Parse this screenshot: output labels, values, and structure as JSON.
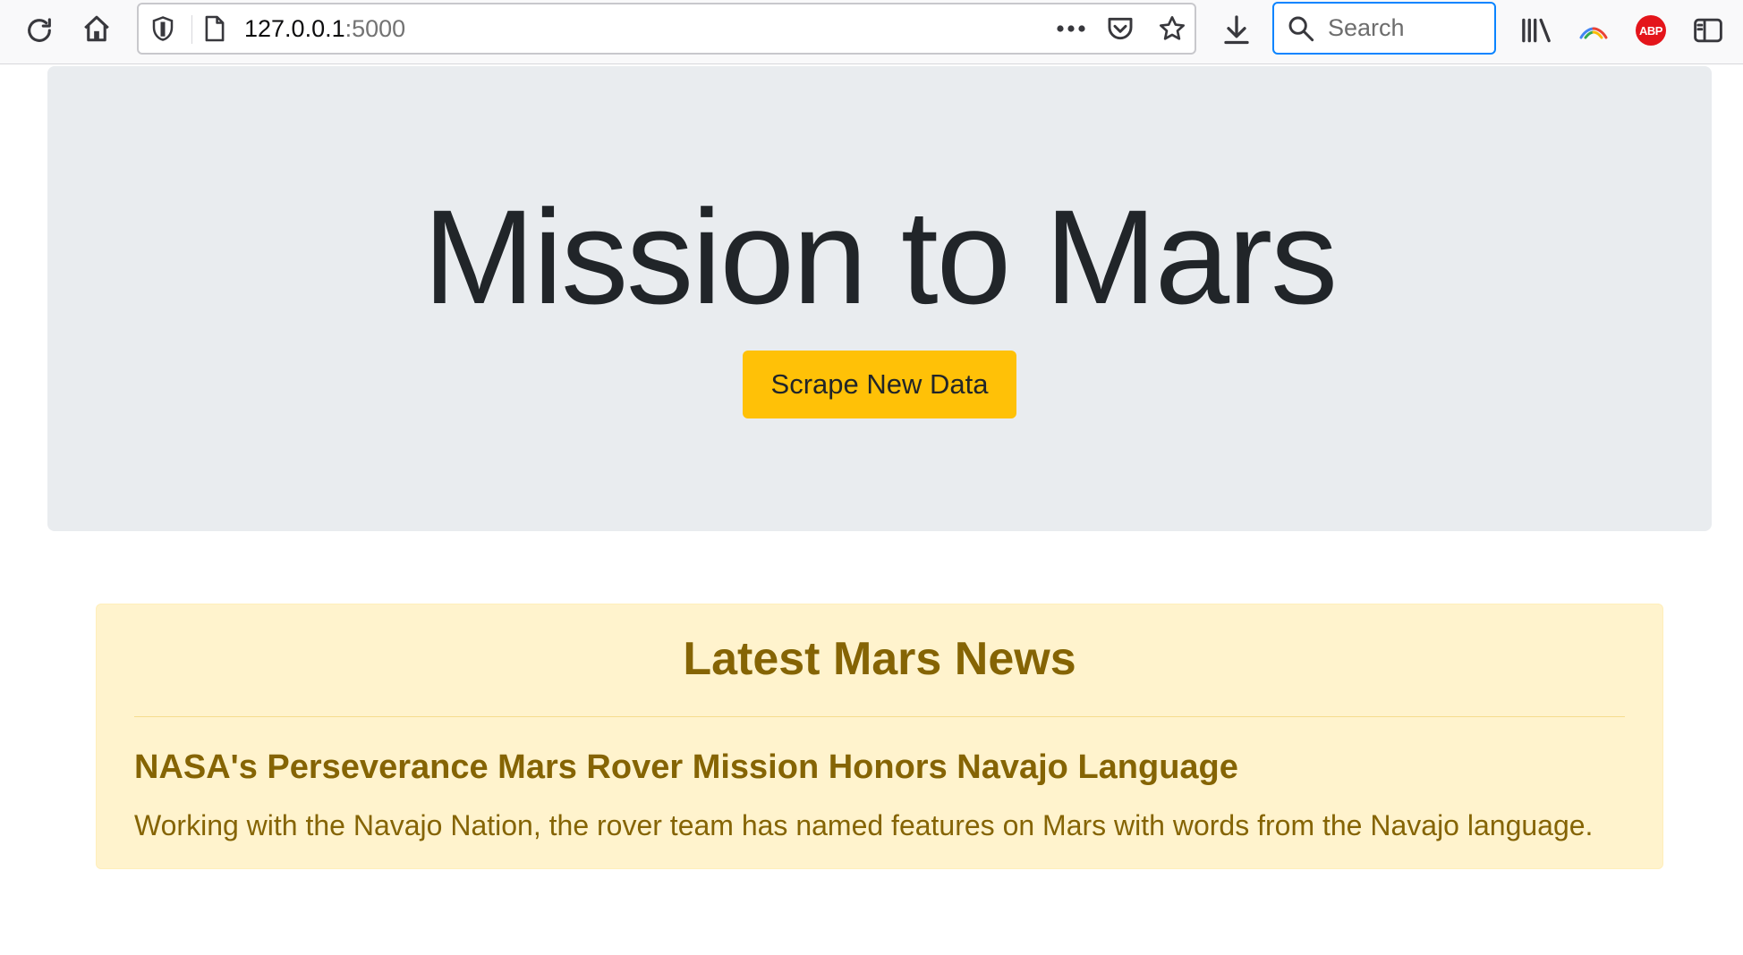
{
  "browser": {
    "url_host": "127.0.0.1",
    "url_port": ":5000",
    "search_placeholder": "Search",
    "adblock_badge": "ABP",
    "icons": {
      "reload": "reload-icon",
      "home": "home-icon",
      "tracking_protection": "shield-icon",
      "page_info": "page-icon",
      "page_actions": "more-dots-icon",
      "pocket": "pocket-icon",
      "bookmark": "star-icon",
      "downloads": "download-icon",
      "search": "search-icon",
      "library": "library-icon",
      "extension": "rainbow-arc-icon",
      "adblock": "adblock-icon",
      "sidebar": "sidebar-icon"
    }
  },
  "hero": {
    "title": "Mission to Mars",
    "button_label": "Scrape New Data",
    "background_color": "#e9ecef",
    "button_color": "#ffc107"
  },
  "news": {
    "heading": "Latest Mars News",
    "title": "NASA's Perseverance Mars Rover Mission Honors Navajo Language",
    "teaser": "Working with the Navajo Nation, the rover team has named features on Mars with words from the Navajo language.",
    "background_color": "#fff3cd",
    "text_color": "#856404"
  }
}
